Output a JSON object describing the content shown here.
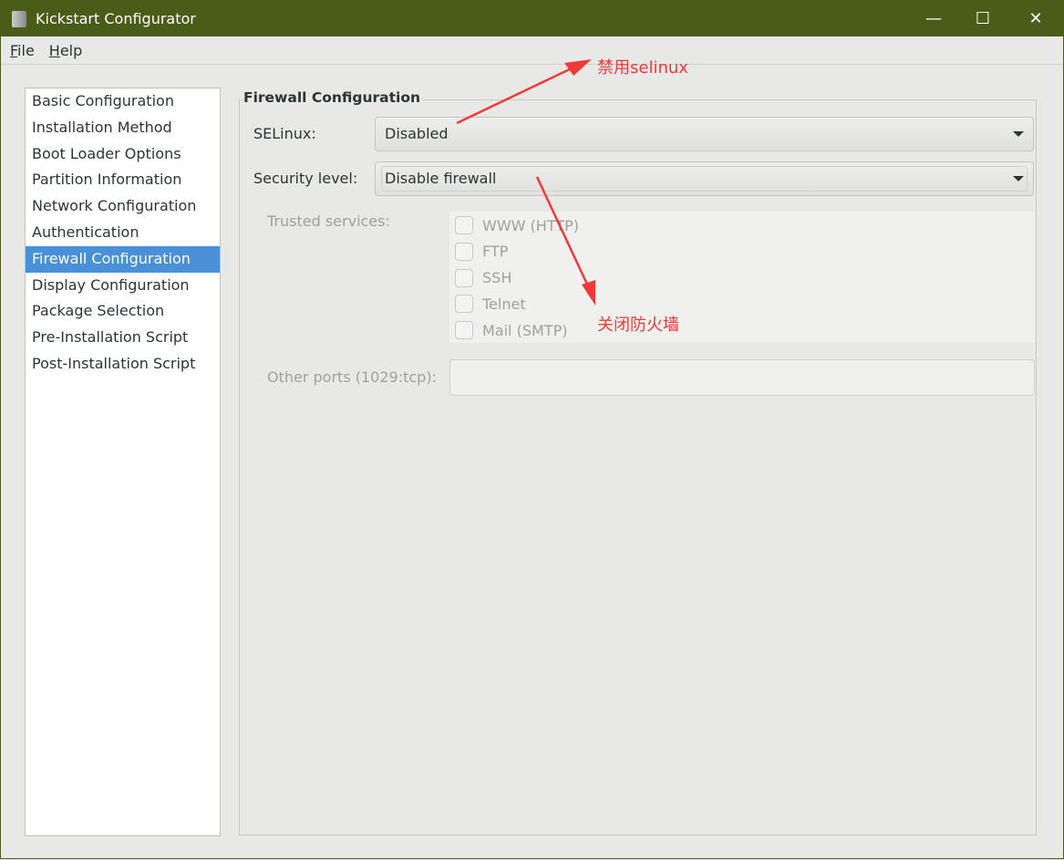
{
  "window": {
    "title": "Kickstart Configurator",
    "minimize": "—",
    "maximize": "☐",
    "close": "✕"
  },
  "menu": [
    {
      "key": "F",
      "rest": "ile"
    },
    {
      "key": "H",
      "rest": "elp"
    }
  ],
  "sidebar": {
    "items": [
      "Basic Configuration",
      "Installation Method",
      "Boot Loader Options",
      "Partition Information",
      "Network Configuration",
      "Authentication",
      "Firewall Configuration",
      "Display Configuration",
      "Package Selection",
      "Pre-Installation Script",
      "Post-Installation Script"
    ],
    "selected": "Firewall Configuration"
  },
  "firewall": {
    "title": "Firewall Configuration",
    "selinux_label": "SELinux:",
    "selinux_value": "Disabled",
    "security_label": "Security level:",
    "security_value": "Disable firewall",
    "trusted_label": "Trusted services:",
    "services": [
      "WWW (HTTP)",
      "FTP",
      "SSH",
      "Telnet",
      "Mail (SMTP)"
    ],
    "ports_label": "Other ports (1029:tcp):",
    "ports_value": ""
  },
  "annotations": {
    "selinux": "禁用selinux",
    "firewall": "关闭防火墙",
    "color": "#f03a3a"
  }
}
